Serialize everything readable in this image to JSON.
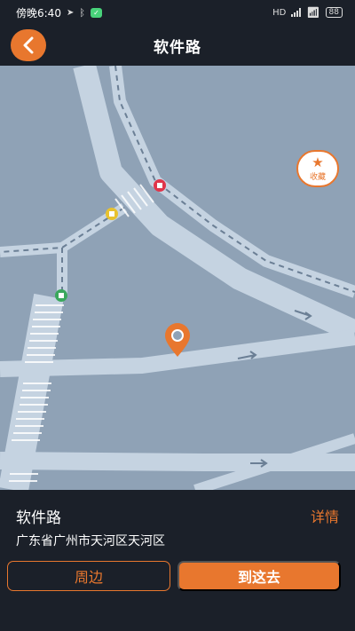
{
  "status_bar": {
    "time": "傍晚6:40",
    "network": "HD",
    "battery": "88"
  },
  "header": {
    "title": "软件路",
    "back_icon": "chevron-left-icon"
  },
  "map": {
    "favorite_label": "收藏",
    "favorite_icon": "star-icon",
    "marker_icon": "location-pin-icon"
  },
  "panel": {
    "place_name": "软件路",
    "detail_label": "详情",
    "address": "广东省广州市天河区天河区",
    "nearby_label": "周边",
    "go_label": "到这去"
  },
  "colors": {
    "accent": "#e8772e",
    "background": "#1b2029",
    "map_bg": "#8fa2b6",
    "road": "#c5d3e1"
  }
}
